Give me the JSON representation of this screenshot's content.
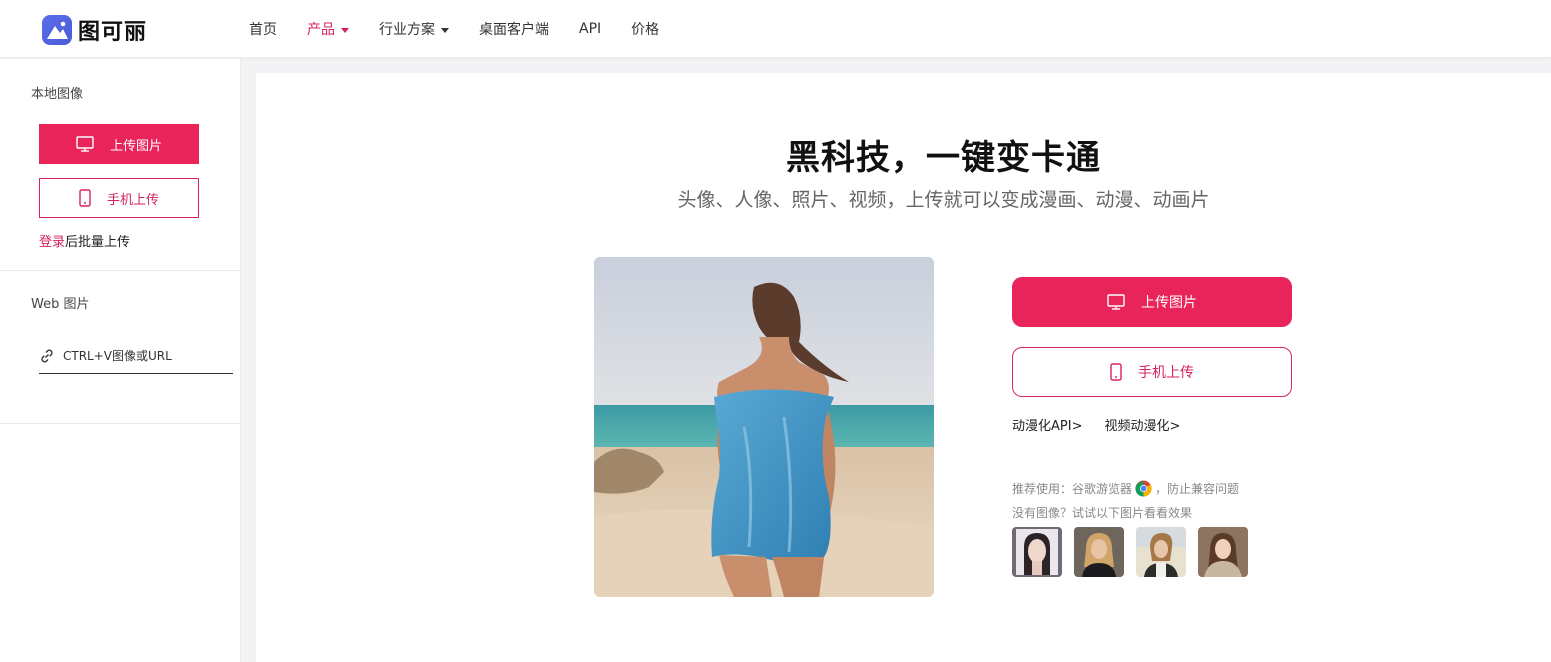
{
  "brand": {
    "name": "图可丽"
  },
  "nav": {
    "items": [
      {
        "label": "首页"
      },
      {
        "label": "产品"
      },
      {
        "label": "行业方案"
      },
      {
        "label": "桌面客户端"
      },
      {
        "label": "API"
      },
      {
        "label": "价格"
      }
    ]
  },
  "sidebar": {
    "local_title": "本地图像",
    "upload_label": "上传图片",
    "mobile_label": "手机上传",
    "login_link": "登录",
    "login_suffix": "后批量上传",
    "web_title": "Web 图片",
    "url_placeholder": "CTRL+V图像或URL"
  },
  "main": {
    "headline": "黑科技，一键变卡通",
    "subheadline": "头像、人像、照片、视频，上传就可以变成漫画、动漫、动画片",
    "upload_label": "上传图片",
    "mobile_label": "手机上传",
    "links": [
      "动漫化API>",
      "视频动漫化>"
    ],
    "recommend_prefix": "推荐使用：谷歌游览器",
    "recommend_suffix": "，防止兼容问题",
    "try_text": "没有图像？试试以下图片看看效果"
  },
  "colors": {
    "accent": "#e8245b",
    "accent_text": "#d6245a",
    "logo": "#4b5bd6"
  }
}
